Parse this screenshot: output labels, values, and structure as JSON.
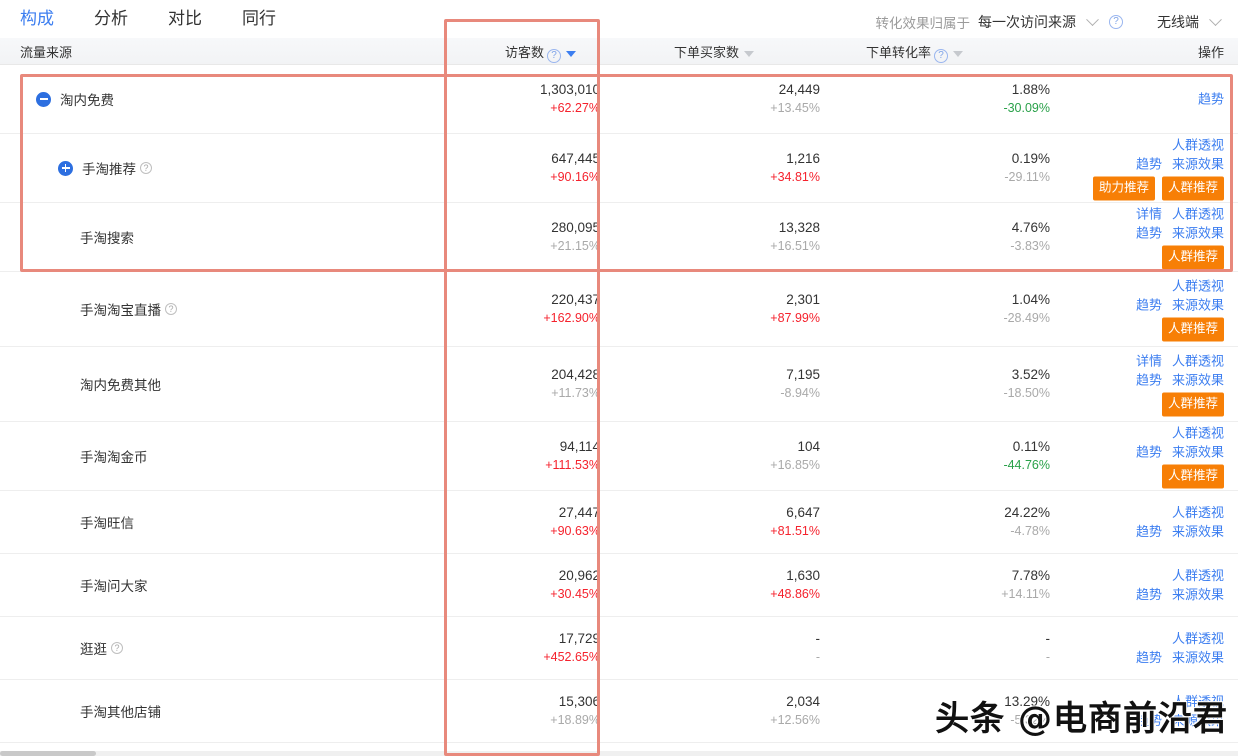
{
  "nav": {
    "tabs": [
      {
        "label": "构成",
        "active": true
      },
      {
        "label": "分析",
        "active": false
      },
      {
        "label": "对比",
        "active": false
      },
      {
        "label": "同行",
        "active": false
      }
    ]
  },
  "toolbar": {
    "attribution_label": "转化效果归属于",
    "attribution_value": "每一次访问来源",
    "help_icon": "question-circle-icon",
    "device_value": "无线端"
  },
  "table": {
    "headers": [
      {
        "label": "流量来源",
        "sortable": false
      },
      {
        "label": "访客数",
        "help": true,
        "sortable": true,
        "sorted": true
      },
      {
        "label": "下单买家数",
        "help": false,
        "sortable": true,
        "sorted": false
      },
      {
        "label": "下单转化率",
        "help": true,
        "sortable": true,
        "sorted": false
      },
      {
        "label": "操作",
        "sortable": false
      }
    ],
    "rows": [
      {
        "name": "淘内免费",
        "indent": 0,
        "toggle": "minus",
        "help": false,
        "visitors": {
          "value": "1,303,010",
          "delta": "+62.27%",
          "dir": "up"
        },
        "buyers": {
          "value": "24,449",
          "delta": "+13.45%",
          "dir": "flat"
        },
        "conv": {
          "value": "1.88%",
          "delta": "-30.09%",
          "dir": "down"
        },
        "links": [
          "趋势"
        ],
        "badges": []
      },
      {
        "name": "手淘推荐",
        "indent": 1,
        "toggle": "plus",
        "help": true,
        "visitors": {
          "value": "647,445",
          "delta": "+90.16%",
          "dir": "up"
        },
        "buyers": {
          "value": "1,216",
          "delta": "+34.81%",
          "dir": "up"
        },
        "conv": {
          "value": "0.19%",
          "delta": "-29.11%",
          "dir": "flat"
        },
        "links": [
          "人群透视",
          "趋势",
          "来源效果"
        ],
        "badges": [
          "助力推荐",
          "人群推荐"
        ]
      },
      {
        "name": "手淘搜索",
        "indent": 1,
        "toggle": "none",
        "help": false,
        "visitors": {
          "value": "280,095",
          "delta": "+21.15%",
          "dir": "flat"
        },
        "buyers": {
          "value": "13,328",
          "delta": "+16.51%",
          "dir": "flat"
        },
        "conv": {
          "value": "4.76%",
          "delta": "-3.83%",
          "dir": "flat"
        },
        "links": [
          "详情",
          "人群透视",
          "趋势",
          "来源效果"
        ],
        "badges": [
          "人群推荐"
        ]
      },
      {
        "name": "手淘淘宝直播",
        "indent": 1,
        "toggle": "none",
        "help": true,
        "visitors": {
          "value": "220,437",
          "delta": "+162.90%",
          "dir": "up"
        },
        "buyers": {
          "value": "2,301",
          "delta": "+87.99%",
          "dir": "up"
        },
        "conv": {
          "value": "1.04%",
          "delta": "-28.49%",
          "dir": "flat"
        },
        "links": [
          "人群透视",
          "趋势",
          "来源效果"
        ],
        "badges": [
          "人群推荐"
        ]
      },
      {
        "name": "淘内免费其他",
        "indent": 1,
        "toggle": "none",
        "help": false,
        "visitors": {
          "value": "204,428",
          "delta": "+11.73%",
          "dir": "flat"
        },
        "buyers": {
          "value": "7,195",
          "delta": "-8.94%",
          "dir": "flat"
        },
        "conv": {
          "value": "3.52%",
          "delta": "-18.50%",
          "dir": "flat"
        },
        "links": [
          "详情",
          "人群透视",
          "趋势",
          "来源效果"
        ],
        "badges": [
          "人群推荐"
        ]
      },
      {
        "name": "手淘淘金币",
        "indent": 1,
        "toggle": "none",
        "help": false,
        "visitors": {
          "value": "94,114",
          "delta": "+111.53%",
          "dir": "up"
        },
        "buyers": {
          "value": "104",
          "delta": "+16.85%",
          "dir": "flat"
        },
        "conv": {
          "value": "0.11%",
          "delta": "-44.76%",
          "dir": "down"
        },
        "links": [
          "人群透视",
          "趋势",
          "来源效果"
        ],
        "badges": [
          "人群推荐"
        ]
      },
      {
        "name": "手淘旺信",
        "indent": 1,
        "toggle": "none",
        "help": false,
        "visitors": {
          "value": "27,447",
          "delta": "+90.63%",
          "dir": "up"
        },
        "buyers": {
          "value": "6,647",
          "delta": "+81.51%",
          "dir": "up"
        },
        "conv": {
          "value": "24.22%",
          "delta": "-4.78%",
          "dir": "flat"
        },
        "links": [
          "人群透视",
          "趋势",
          "来源效果"
        ],
        "badges": []
      },
      {
        "name": "手淘问大家",
        "indent": 1,
        "toggle": "none",
        "help": false,
        "visitors": {
          "value": "20,962",
          "delta": "+30.45%",
          "dir": "up"
        },
        "buyers": {
          "value": "1,630",
          "delta": "+48.86%",
          "dir": "up"
        },
        "conv": {
          "value": "7.78%",
          "delta": "+14.11%",
          "dir": "flat"
        },
        "links": [
          "人群透视",
          "趋势",
          "来源效果"
        ],
        "badges": []
      },
      {
        "name": "逛逛",
        "indent": 1,
        "toggle": "none",
        "help": true,
        "visitors": {
          "value": "17,729",
          "delta": "+452.65%",
          "dir": "up"
        },
        "buyers": {
          "value": "-",
          "delta": "-",
          "dir": "flat"
        },
        "conv": {
          "value": "-",
          "delta": "-",
          "dir": "flat"
        },
        "links": [
          "人群透视",
          "趋势",
          "来源效果"
        ],
        "badges": []
      },
      {
        "name": "手淘其他店铺",
        "indent": 1,
        "toggle": "none",
        "help": false,
        "visitors": {
          "value": "15,306",
          "delta": "+18.89%",
          "dir": "flat"
        },
        "buyers": {
          "value": "2,034",
          "delta": "+12.56%",
          "dir": "flat"
        },
        "conv": {
          "value": "13.29%",
          "delta": "-5.32%",
          "dir": "flat"
        },
        "links": [
          "人群透视",
          "趋势",
          "来源效果"
        ],
        "badges": []
      }
    ]
  },
  "annotations": [
    {
      "name": "highlight-rows-box",
      "color": "#e8897c"
    },
    {
      "name": "highlight-visitors-column-box",
      "color": "#e8897c"
    }
  ],
  "watermark": {
    "text": "头条 @电商前沿君"
  },
  "colors": {
    "accent_blue": "#3c7ef0",
    "up_red": "#f5222d",
    "down_green": "#2aa14a",
    "badge_orange": "#f77f06",
    "annotation": "#e8897c"
  }
}
